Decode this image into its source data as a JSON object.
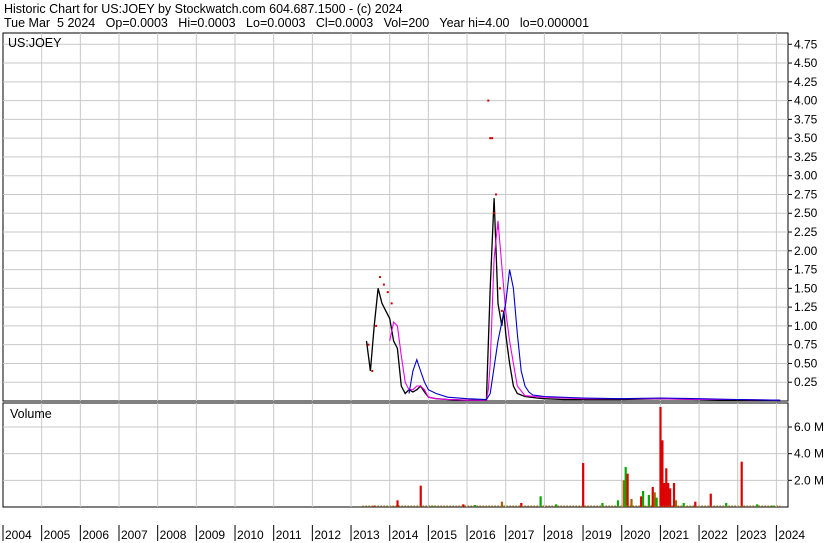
{
  "header": {
    "line1": "Historic Chart for US:JOEY by Stockwatch.com 604.687.1500 - (c) 2024",
    "line2": "Tue Mar  5 2024   Op=0.0003   Hi=0.0003   Lo=0.0003   Cl=0.0003   Vol=200   Year hi=4.00   lo=0.000001"
  },
  "chart_data": [
    {
      "type": "line",
      "panel": "price",
      "title": "US:JOEY",
      "ylim": [
        0,
        4.9
      ],
      "yticks": [
        "0.25",
        "0.50",
        "0.75",
        "1.00",
        "1.25",
        "1.50",
        "1.75",
        "2.00",
        "2.25",
        "2.50",
        "2.75",
        "3.00",
        "3.25",
        "3.50",
        "3.75",
        "4.00",
        "4.25",
        "4.50",
        "4.75"
      ],
      "xlim": [
        2004,
        2024.3
      ],
      "xticks": [
        "2004",
        "2005",
        "2006",
        "2007",
        "2008",
        "2009",
        "2010",
        "2011",
        "2012",
        "2013",
        "2014",
        "2015",
        "2016",
        "2017",
        "2018",
        "2019",
        "2020",
        "2021",
        "2022",
        "2023",
        "2024"
      ],
      "grid": true,
      "colors": {
        "price": "#000000",
        "price_dot": "#cc0000",
        "ma_short": "#ee00ee",
        "ma_long": "#0000cc",
        "grid": "#c8c8c8"
      },
      "series": [
        {
          "role": "price",
          "x": [
            2013.4,
            2013.5,
            2013.6,
            2013.7,
            2013.8,
            2013.9,
            2014.0,
            2014.1,
            2014.2,
            2014.3,
            2014.4,
            2014.5,
            2014.6,
            2014.7,
            2014.8,
            2014.9,
            2015.0,
            2015.2,
            2015.5,
            2016.0,
            2016.5,
            2016.6,
            2016.7,
            2016.8,
            2016.9,
            2016.95,
            2017.0,
            2017.05,
            2017.1,
            2017.2,
            2017.3,
            2017.5,
            2017.8,
            2018.0,
            2018.5,
            2019,
            2020,
            2021,
            2022,
            2023,
            2024.1
          ],
          "y": [
            0.8,
            0.4,
            1.0,
            1.5,
            1.3,
            1.2,
            1.1,
            0.8,
            0.7,
            0.2,
            0.1,
            0.15,
            0.12,
            0.15,
            0.2,
            0.12,
            0.05,
            0.03,
            0.02,
            0.01,
            0.01,
            1.5,
            2.7,
            1.3,
            1.0,
            1.2,
            0.9,
            0.7,
            0.5,
            0.2,
            0.1,
            0.06,
            0.04,
            0.03,
            0.02,
            0.02,
            0.02,
            0.03,
            0.02,
            0.01,
            0.0003
          ]
        },
        {
          "role": "price_dot",
          "x": [
            2013.45,
            2013.55,
            2013.65,
            2013.75,
            2013.85,
            2013.95,
            2014.05,
            2016.55,
            2016.6,
            2016.65,
            2016.7,
            2016.75,
            2016.8,
            2016.85,
            2016.9
          ],
          "y": [
            0.75,
            0.4,
            1.0,
            1.65,
            1.55,
            1.45,
            1.3,
            4.0,
            3.5,
            3.5,
            2.5,
            2.75,
            2.3,
            1.5,
            1.2
          ]
        },
        {
          "role": "ma_short",
          "x": [
            2014.0,
            2014.1,
            2014.2,
            2014.3,
            2014.4,
            2014.5,
            2014.6,
            2014.7,
            2014.8,
            2014.9,
            2015.0,
            2015.2,
            2015.5,
            2016.0,
            2016.5,
            2016.55,
            2016.6,
            2016.7,
            2016.8,
            2016.9,
            2017.0,
            2017.1,
            2017.2,
            2017.3,
            2017.5,
            2018,
            2019,
            2020,
            2021,
            2022,
            2023,
            2024.1
          ],
          "y": [
            0.8,
            1.05,
            1.0,
            0.6,
            0.25,
            0.15,
            0.15,
            0.2,
            0.2,
            0.15,
            0.05,
            0.03,
            0.02,
            0.01,
            0.01,
            0.15,
            0.5,
            1.9,
            2.4,
            1.8,
            1.2,
            0.8,
            0.5,
            0.2,
            0.07,
            0.05,
            0.03,
            0.03,
            0.03,
            0.02,
            0.02,
            0.01
          ]
        },
        {
          "role": "ma_long",
          "x": [
            2014.5,
            2014.6,
            2014.7,
            2014.8,
            2014.9,
            2015.0,
            2015.2,
            2015.5,
            2016.0,
            2016.5,
            2016.6,
            2016.8,
            2017.0,
            2017.1,
            2017.2,
            2017.3,
            2017.4,
            2017.5,
            2017.6,
            2017.7,
            2018,
            2019,
            2020,
            2021,
            2022,
            2023,
            2024.1
          ],
          "y": [
            0.1,
            0.4,
            0.55,
            0.4,
            0.25,
            0.15,
            0.1,
            0.05,
            0.03,
            0.02,
            0.1,
            0.8,
            1.3,
            1.75,
            1.5,
            0.9,
            0.4,
            0.2,
            0.12,
            0.08,
            0.06,
            0.04,
            0.03,
            0.04,
            0.03,
            0.02,
            0.01
          ]
        }
      ]
    },
    {
      "type": "bar",
      "panel": "volume",
      "title": "Volume",
      "ylim": [
        0,
        7.8
      ],
      "yticks": [
        "2.0 M",
        "4.0 M",
        "6.0 M"
      ],
      "colors": {
        "up": "#00aa00",
        "down": "#dd0000",
        "flat": "#996600"
      },
      "bars": [
        {
          "x": 2013.6,
          "v": 0.1,
          "c": "down"
        },
        {
          "x": 2014.2,
          "v": 0.5,
          "c": "down"
        },
        {
          "x": 2014.8,
          "v": 1.6,
          "c": "down"
        },
        {
          "x": 2015.1,
          "v": 0.1,
          "c": "up"
        },
        {
          "x": 2015.9,
          "v": 0.2,
          "c": "down"
        },
        {
          "x": 2016.2,
          "v": 0.15,
          "c": "up"
        },
        {
          "x": 2016.9,
          "v": 0.4,
          "c": "flat"
        },
        {
          "x": 2017.4,
          "v": 0.3,
          "c": "down"
        },
        {
          "x": 2017.9,
          "v": 0.8,
          "c": "up"
        },
        {
          "x": 2018.3,
          "v": 0.2,
          "c": "up"
        },
        {
          "x": 2019.0,
          "v": 3.3,
          "c": "down"
        },
        {
          "x": 2019.5,
          "v": 0.3,
          "c": "up"
        },
        {
          "x": 2019.9,
          "v": 0.5,
          "c": "up"
        },
        {
          "x": 2020.05,
          "v": 2.0,
          "c": "flat"
        },
        {
          "x": 2020.1,
          "v": 3.0,
          "c": "up"
        },
        {
          "x": 2020.15,
          "v": 2.5,
          "c": "down"
        },
        {
          "x": 2020.25,
          "v": 0.6,
          "c": "flat"
        },
        {
          "x": 2020.5,
          "v": 0.8,
          "c": "down"
        },
        {
          "x": 2020.55,
          "v": 1.2,
          "c": "up"
        },
        {
          "x": 2020.7,
          "v": 0.9,
          "c": "up"
        },
        {
          "x": 2020.8,
          "v": 1.5,
          "c": "down"
        },
        {
          "x": 2020.85,
          "v": 1.1,
          "c": "flat"
        },
        {
          "x": 2020.9,
          "v": 0.7,
          "c": "up"
        },
        {
          "x": 2021.0,
          "v": 7.5,
          "c": "down"
        },
        {
          "x": 2021.05,
          "v": 5.0,
          "c": "down"
        },
        {
          "x": 2021.1,
          "v": 1.8,
          "c": "down"
        },
        {
          "x": 2021.15,
          "v": 2.9,
          "c": "down"
        },
        {
          "x": 2021.2,
          "v": 1.8,
          "c": "down"
        },
        {
          "x": 2021.25,
          "v": 1.4,
          "c": "down"
        },
        {
          "x": 2021.35,
          "v": 1.8,
          "c": "down"
        },
        {
          "x": 2021.4,
          "v": 0.5,
          "c": "flat"
        },
        {
          "x": 2021.6,
          "v": 0.3,
          "c": "up"
        },
        {
          "x": 2021.9,
          "v": 0.4,
          "c": "down"
        },
        {
          "x": 2022.3,
          "v": 1.0,
          "c": "down"
        },
        {
          "x": 2022.7,
          "v": 0.3,
          "c": "up"
        },
        {
          "x": 2023.1,
          "v": 3.4,
          "c": "down"
        },
        {
          "x": 2023.5,
          "v": 0.2,
          "c": "up"
        },
        {
          "x": 2023.9,
          "v": 0.1,
          "c": "up"
        }
      ]
    }
  ]
}
